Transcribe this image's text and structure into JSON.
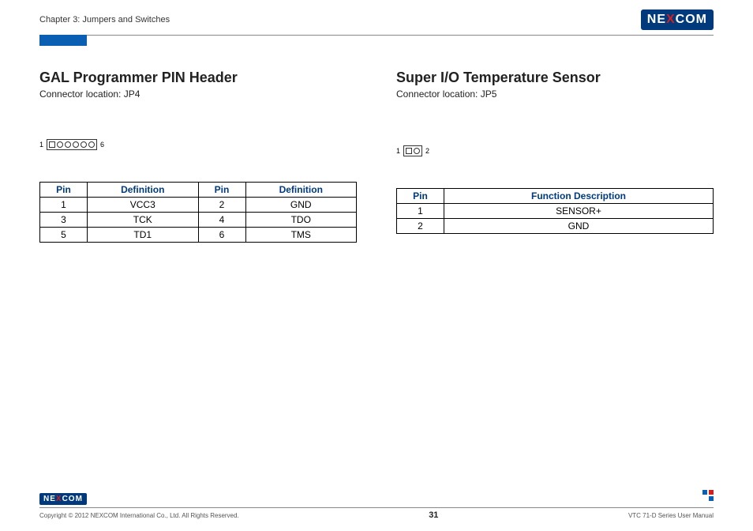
{
  "header": {
    "chapter": "Chapter 3: Jumpers and Switches",
    "logo_parts": {
      "pre": "NE",
      "x": "X",
      "post": "COM"
    }
  },
  "left": {
    "title": "GAL Programmer PIN Header",
    "subtitle": "Connector location: JP4",
    "diagram": {
      "left_label": "1",
      "right_label": "6"
    },
    "table": {
      "headers": [
        "Pin",
        "Definition",
        "Pin",
        "Definition"
      ],
      "rows": [
        [
          "1",
          "VCC3",
          "2",
          "GND"
        ],
        [
          "3",
          "TCK",
          "4",
          "TDO"
        ],
        [
          "5",
          "TD1",
          "6",
          "TMS"
        ]
      ]
    }
  },
  "right": {
    "title": "Super I/O Temperature Sensor",
    "subtitle": "Connector location: JP5",
    "diagram": {
      "left_label": "1",
      "right_label": "2"
    },
    "table": {
      "headers": [
        "Pin",
        "Function Description"
      ],
      "rows": [
        [
          "1",
          "SENSOR+"
        ],
        [
          "2",
          "GND"
        ]
      ]
    }
  },
  "footer": {
    "copyright": "Copyright © 2012 NEXCOM International Co., Ltd. All Rights Reserved.",
    "page": "31",
    "manual": "VTC 71-D Series User Manual",
    "logo_parts": {
      "pre": "NE",
      "x": "X",
      "post": "COM"
    }
  }
}
